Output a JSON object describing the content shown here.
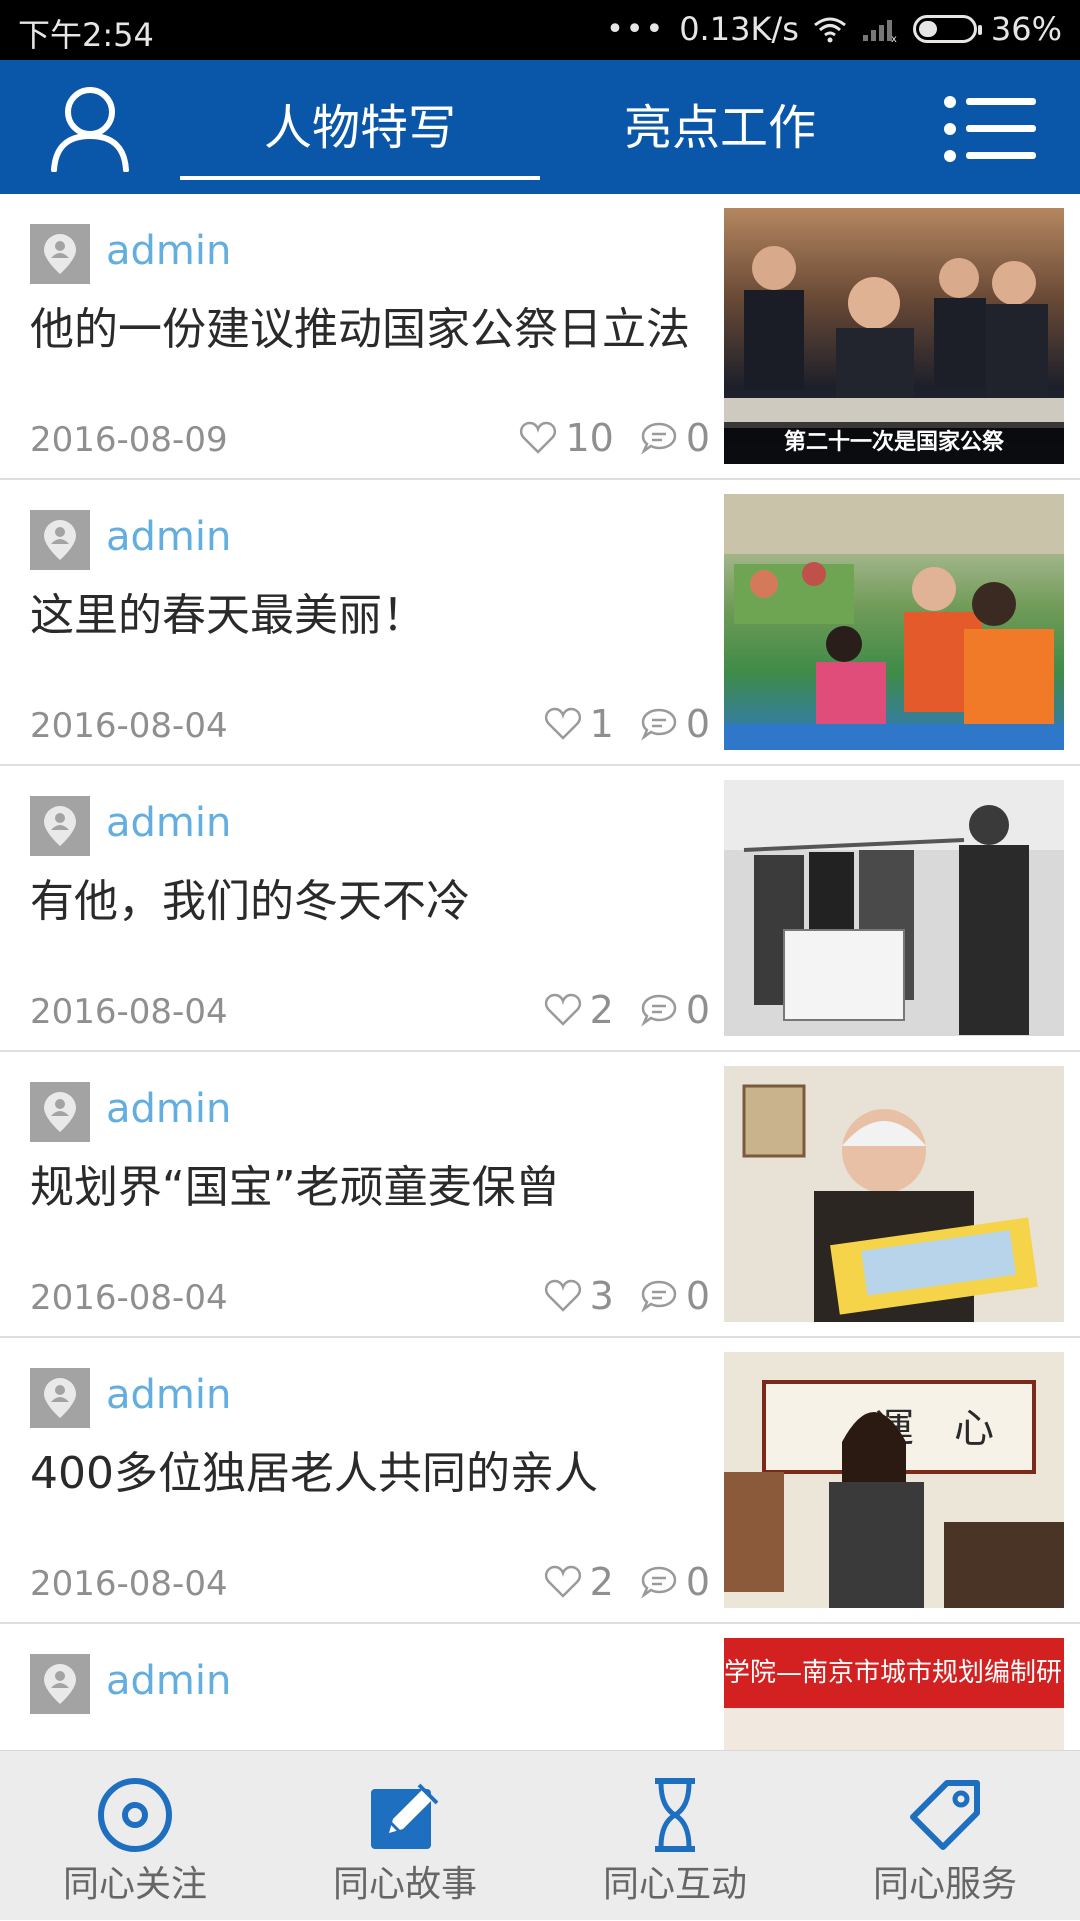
{
  "status_bar": {
    "time": "下午2:54",
    "network_speed": "0.13K/s",
    "battery": "36%"
  },
  "header": {
    "tabs": [
      {
        "label": "人物特写",
        "active": true
      },
      {
        "label": "亮点工作",
        "active": false
      }
    ],
    "accent_color": "#0a56a8"
  },
  "articles": [
    {
      "author": "admin",
      "title": "他的一份建议推动国家公祭日立法",
      "date": "2016-08-09",
      "likes": "10",
      "comments": "0",
      "thumb_caption": "第二十一次是国家公祭"
    },
    {
      "author": "admin",
      "title": "这里的春天最美丽！",
      "date": "2016-08-04",
      "likes": "1",
      "comments": "0"
    },
    {
      "author": "admin",
      "title": "有他，我们的冬天不冷",
      "date": "2016-08-04",
      "likes": "2",
      "comments": "0"
    },
    {
      "author": "admin",
      "title": "规划界“国宝”老顽童麦保曾",
      "date": "2016-08-04",
      "likes": "3",
      "comments": "0"
    },
    {
      "author": "admin",
      "title": "400多位独居老人共同的亲人",
      "date": "2016-08-04",
      "likes": "2",
      "comments": "0"
    },
    {
      "author": "admin",
      "title": "",
      "date": "",
      "likes": "",
      "comments": "",
      "thumb_banner": "学院—南京市城市规划编制研究中心共建实习基地签约"
    }
  ],
  "bottom_nav": [
    {
      "label": "同心关注",
      "icon": "target-icon"
    },
    {
      "label": "同心故事",
      "icon": "edit-icon"
    },
    {
      "label": "同心互动",
      "icon": "hourglass-icon"
    },
    {
      "label": "同心服务",
      "icon": "tag-icon"
    }
  ]
}
